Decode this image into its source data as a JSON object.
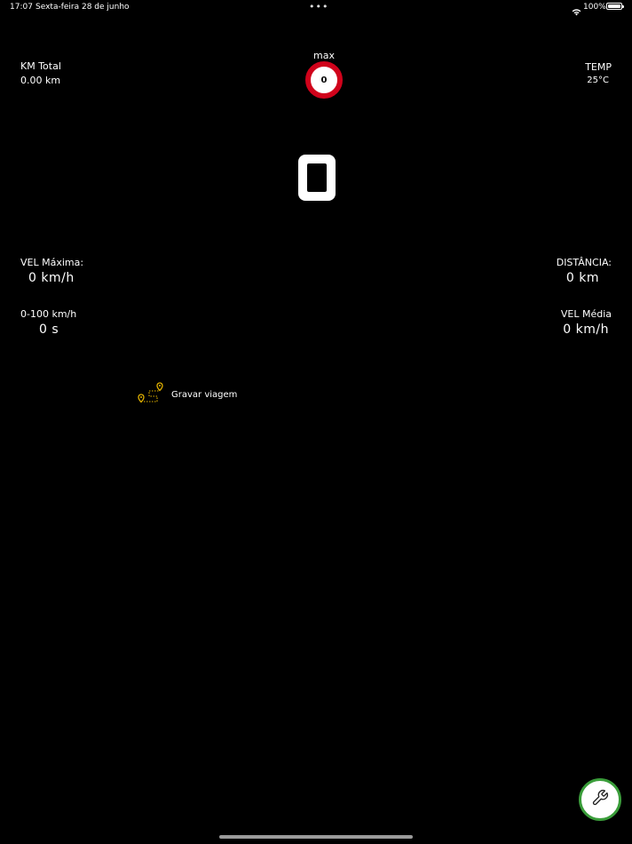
{
  "status_bar": {
    "time": "17:07",
    "date": "Sexta-feira 28 de junho",
    "more": "•••",
    "battery": "100%"
  },
  "odometer": {
    "label": "KM Total",
    "value": "0.00 km"
  },
  "speed_limit": {
    "label": "max",
    "value": "0"
  },
  "temperature": {
    "label": "TEMP",
    "value": "25°C"
  },
  "speed": {
    "value": "0"
  },
  "max_speed": {
    "label": "VEL Máxima:",
    "value": "0 km/h"
  },
  "distance": {
    "label": "DISTÂNCIA:",
    "value": "0 km"
  },
  "acceleration": {
    "label": "0-100 km/h",
    "value": "0 s"
  },
  "avg_speed": {
    "label": "VEL Média",
    "value": "0 km/h"
  },
  "record_trip": {
    "label": "Gravar viagem"
  },
  "colors": {
    "background": "#000000",
    "text": "#ffffff",
    "sign_ring": "#d0021b",
    "route_icon": "#e0b000",
    "settings_ring": "#3a9d3a"
  },
  "icons": {
    "wifi": "wifi-icon",
    "battery": "battery-icon",
    "route": "route-icon",
    "settings": "wrench-icon"
  }
}
